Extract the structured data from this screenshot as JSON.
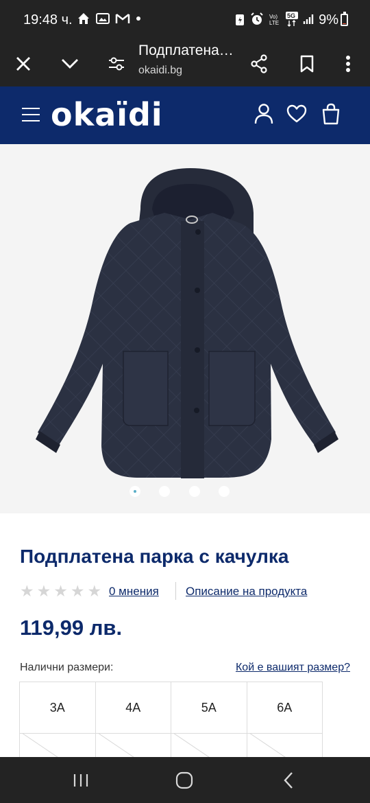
{
  "status_bar": {
    "time": "19:48 ч.",
    "battery": "9%",
    "battery_level": 0.09,
    "network": "5G",
    "signal_label": "Vo) LTE"
  },
  "browser": {
    "title": "Подплатена парка с качулка",
    "url": "okaidi.bg"
  },
  "site": {
    "logo": "okaïdi",
    "brand_color": "#0d2a6b"
  },
  "gallery": {
    "slide_count": 4,
    "active_slide": 1
  },
  "product": {
    "name": "Подплатена парка с качулка",
    "rating": 0,
    "max_rating": 5,
    "reviews_link": "0 мнения",
    "description_link": "Описание на продукта",
    "price": "119,99 лв."
  },
  "sizes": {
    "label": "Налични размери:",
    "guide_link": "Кой е вашият размер?",
    "available": [
      "3A",
      "4A",
      "5A",
      "6A"
    ]
  }
}
